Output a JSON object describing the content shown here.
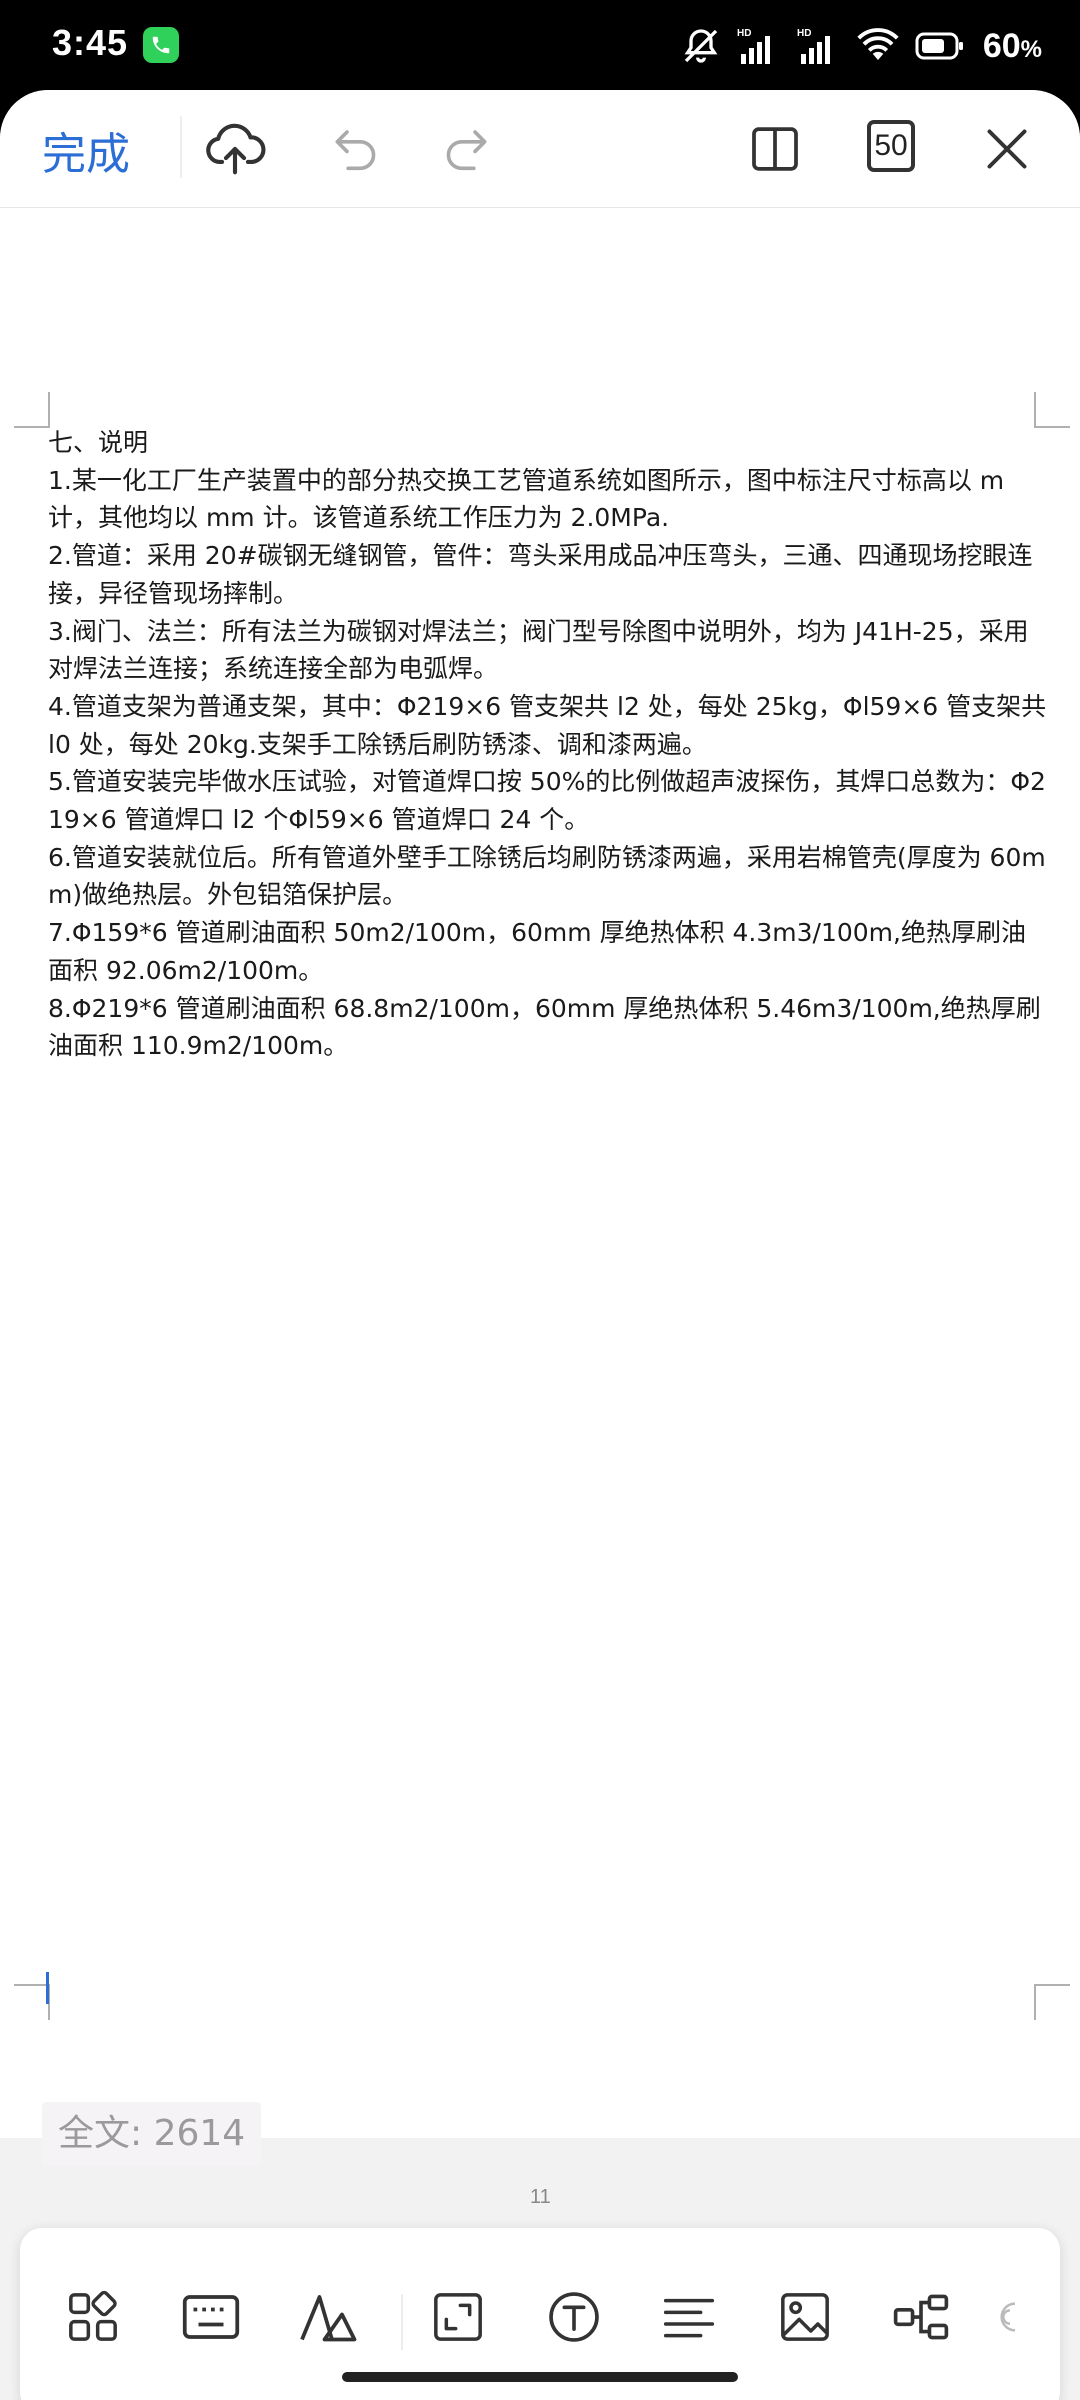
{
  "status_bar": {
    "time": "3:45",
    "call_icon": "phone-icon",
    "network_labels": [
      "HD",
      "HD"
    ],
    "battery_percent": "60",
    "battery_unit": "%"
  },
  "toolbar": {
    "done_label": "完成",
    "zoom_value": "50",
    "icons": [
      "cloud-upload-icon",
      "undo-icon",
      "redo-icon",
      "split-view-icon",
      "zoom-icon",
      "close-icon"
    ]
  },
  "document": {
    "lines": [
      "七、说明",
      "1.某一化工厂生产装置中的部分热交换工艺管道系统如图所示，图中标注尺寸标高以 m 计，其他均以 mm 计。该管道系统工作压力为 2.0MPa.",
      "2.管道：采用 20#碳钢无缝钢管，管件：弯头采用成品冲压弯头，三通、四通现场挖眼连接，异径管现场摔制。",
      "3.阀门、法兰：所有法兰为碳钢对焊法兰；阀门型号除图中说明外，均为 J41H-25，采用对焊法兰连接；系统连接全部为电弧焊。",
      "4.管道支架为普通支架，其中：Φ219×6 管支架共 l2 处，每处 25kg，Φl59×6 管支架共 l0 处，每处 20kg.支架手工除锈后刷防锈漆、调和漆两遍。",
      "5.管道安装完毕做水压试验，对管道焊口按 50%的比例做超声波探伤，其焊口总数为：Φ219×6 管道焊口 l2 个Φl59×6 管道焊口 24 个。",
      "6.管道安装就位后。所有管道外壁手工除锈后均刷防锈漆两遍，采用岩棉管壳(厚度为 60mm)做绝热层。外包铝箔保护层。",
      "7.Φ159*6 管道刷油面积 50m2/100m，60mm 厚绝热体积 4.3m3/100m,绝热厚刷油面积 92.06m2/100m。",
      "8.Φ219*6 管道刷油面积 68.8m2/100m，60mm 厚绝热体积 5.46m3/100m,绝热厚刷油面积 110.9m2/100m。"
    ],
    "page_number": "11",
    "word_count_label": "全文: 2614"
  },
  "bottom_toolbar": {
    "icons": [
      "grid-icon",
      "keyboard-icon",
      "font-style-icon",
      "fit-screen-icon",
      "text-icon",
      "align-left-icon",
      "image-icon",
      "structure-icon",
      "more-icon"
    ]
  }
}
